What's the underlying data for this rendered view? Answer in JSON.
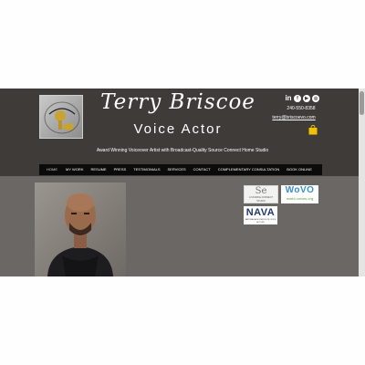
{
  "header": {
    "brand_name": "Terry Briscoe",
    "subtitle": "Voice Actor",
    "tagline": "Award Winning Voiceover Artist with Broadcast-Quality Source Connect Home Studio",
    "phone": "240-550-8358",
    "email": "terry@briscoevo.com",
    "logo_text": "Terry Briscoe Voice"
  },
  "social": {
    "icons": [
      "linkedin-icon",
      "facebook-icon",
      "youtube-icon",
      "instagram-icon"
    ]
  },
  "nav": {
    "items": [
      "HOME",
      "MY WORK",
      "RESUME",
      "PRESS",
      "TESTIMONIALS",
      "SERVICES",
      "CONTACT",
      "COMPLEMENTARY CONSULTATION",
      "BOOK ONLINE"
    ]
  },
  "badges": {
    "se_top": "Se",
    "se_bottom": "A SOURCE-CONNECT STUDIO",
    "wovo_name": "WoVO",
    "wovo_url": "world-voices.org",
    "nava_name": "NAVA",
    "nava_sub": "NATIONAL ASSOCIATION OF VOICE ACTORS"
  },
  "colors": {
    "header_bg": "#3e3b39",
    "content_bg": "#6b6764",
    "nav_bg": "#0b0b0b",
    "cart_color": "#f2c200"
  }
}
